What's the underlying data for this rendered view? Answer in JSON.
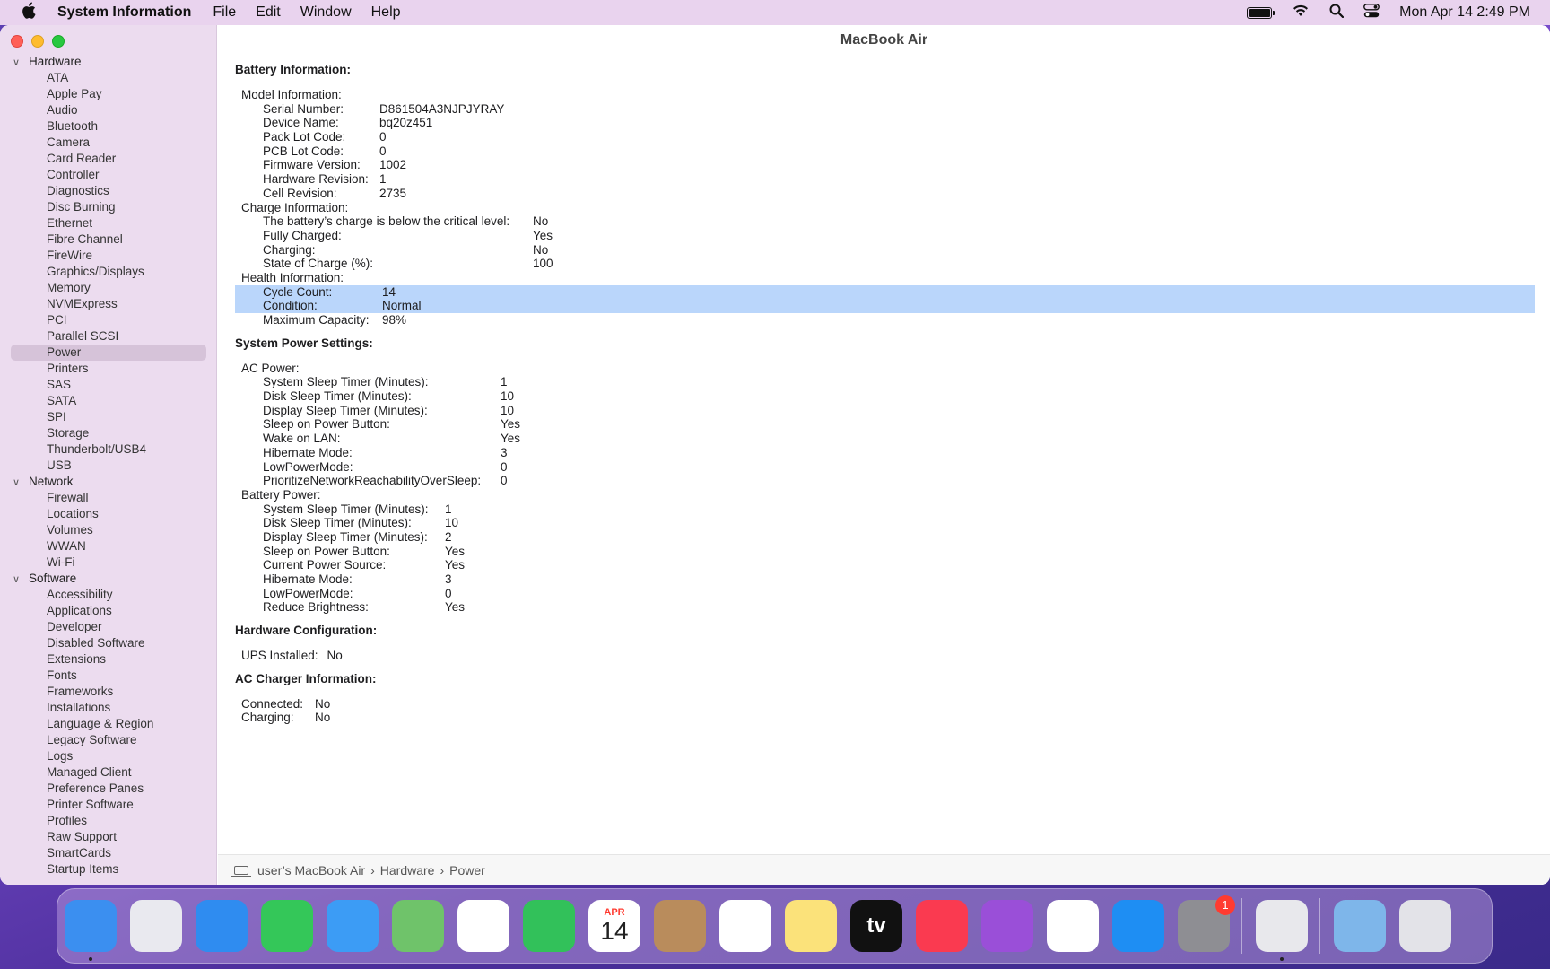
{
  "menubar": {
    "app_name": "System Information",
    "menus": [
      "File",
      "Edit",
      "Window",
      "Help"
    ],
    "clock": "Mon Apr 14  2:49 PM"
  },
  "window": {
    "title": "MacBook Air"
  },
  "sidebar": {
    "groups": [
      {
        "label": "Hardware",
        "items": [
          "ATA",
          "Apple Pay",
          "Audio",
          "Bluetooth",
          "Camera",
          "Card Reader",
          "Controller",
          "Diagnostics",
          "Disc Burning",
          "Ethernet",
          "Fibre Channel",
          "FireWire",
          "Graphics/Displays",
          "Memory",
          "NVMExpress",
          "PCI",
          "Parallel SCSI",
          "Power",
          "Printers",
          "SAS",
          "SATA",
          "SPI",
          "Storage",
          "Thunderbolt/USB4",
          "USB"
        ]
      },
      {
        "label": "Network",
        "items": [
          "Firewall",
          "Locations",
          "Volumes",
          "WWAN",
          "Wi-Fi"
        ]
      },
      {
        "label": "Software",
        "items": [
          "Accessibility",
          "Applications",
          "Developer",
          "Disabled Software",
          "Extensions",
          "Fonts",
          "Frameworks",
          "Installations",
          "Language & Region",
          "Legacy Software",
          "Logs",
          "Managed Client",
          "Preference Panes",
          "Printer Software",
          "Profiles",
          "Raw Support",
          "SmartCards",
          "Startup Items"
        ]
      }
    ],
    "selected": "Power"
  },
  "battery_info": {
    "heading": "Battery Information:",
    "model_label": "Model Information:",
    "model": [
      [
        "Serial Number:",
        "D861504A3NJPJYRAY"
      ],
      [
        "Device Name:",
        "bq20z451"
      ],
      [
        "Pack Lot Code:",
        "0"
      ],
      [
        "PCB Lot Code:",
        "0"
      ],
      [
        "Firmware Version:",
        "1002"
      ],
      [
        "Hardware Revision:",
        "1"
      ],
      [
        "Cell Revision:",
        "2735"
      ]
    ],
    "charge_label": "Charge Information:",
    "charge": [
      [
        "The battery’s charge is below the critical level:",
        "No"
      ],
      [
        "Fully Charged:",
        "Yes"
      ],
      [
        "Charging:",
        "No"
      ],
      [
        "State of Charge (%):",
        "100"
      ]
    ],
    "health_label": "Health Information:",
    "health": [
      [
        "Cycle Count:",
        "14"
      ],
      [
        "Condition:",
        "Normal"
      ],
      [
        "Maximum Capacity:",
        "98%"
      ]
    ]
  },
  "power_settings": {
    "heading": "System Power Settings:",
    "ac_label": "AC Power:",
    "ac": [
      [
        "System Sleep Timer (Minutes):",
        "1"
      ],
      [
        "Disk Sleep Timer (Minutes):",
        "10"
      ],
      [
        "Display Sleep Timer (Minutes):",
        "10"
      ],
      [
        "Sleep on Power Button:",
        "Yes"
      ],
      [
        "Wake on LAN:",
        "Yes"
      ],
      [
        "Hibernate Mode:",
        "3"
      ],
      [
        "LowPowerMode:",
        "0"
      ],
      [
        "PrioritizeNetworkReachabilityOverSleep:",
        "0"
      ]
    ],
    "battery_label": "Battery Power:",
    "battery": [
      [
        "System Sleep Timer (Minutes):",
        "1"
      ],
      [
        "Disk Sleep Timer (Minutes):",
        "10"
      ],
      [
        "Display Sleep Timer (Minutes):",
        "2"
      ],
      [
        "Sleep on Power Button:",
        "Yes"
      ],
      [
        "Current Power Source:",
        "Yes"
      ],
      [
        "Hibernate Mode:",
        "3"
      ],
      [
        "LowPowerMode:",
        "0"
      ],
      [
        "Reduce Brightness:",
        "Yes"
      ]
    ]
  },
  "hardware_config": {
    "heading": "Hardware Configuration:",
    "rows": [
      [
        "UPS Installed:",
        "No"
      ]
    ]
  },
  "ac_charger": {
    "heading": "AC Charger Information:",
    "rows": [
      [
        "Connected:",
        "No"
      ],
      [
        "Charging:",
        "No"
      ]
    ]
  },
  "pathbar": {
    "parts": [
      "user’s MacBook Air",
      "Hardware",
      "Power"
    ],
    "separator": "›"
  },
  "dock": {
    "apps": [
      {
        "name": "Finder",
        "icon": "finder-icon",
        "color": "#3b8ff0",
        "running": true
      },
      {
        "name": "Launchpad",
        "icon": "launchpad-icon",
        "color": "#e9e9ef"
      },
      {
        "name": "Safari",
        "icon": "safari-icon",
        "color": "#2f8cf0"
      },
      {
        "name": "Messages",
        "icon": "messages-icon",
        "color": "#34c759"
      },
      {
        "name": "Mail",
        "icon": "mail-icon",
        "color": "#3c9cf5"
      },
      {
        "name": "Maps",
        "icon": "maps-icon",
        "color": "#6fc36a"
      },
      {
        "name": "Photos",
        "icon": "photos-icon",
        "color": "#ffffff"
      },
      {
        "name": "FaceTime",
        "icon": "facetime-icon",
        "color": "#32c15a"
      },
      {
        "name": "Calendar",
        "icon": "calendar-icon",
        "color": "#ffffff",
        "month": "APR",
        "day": "14"
      },
      {
        "name": "Contacts",
        "icon": "contacts-icon",
        "color": "#b98c5c"
      },
      {
        "name": "Reminders",
        "icon": "reminders-icon",
        "color": "#ffffff"
      },
      {
        "name": "Notes",
        "icon": "notes-icon",
        "color": "#fbe27a"
      },
      {
        "name": "TV",
        "icon": "apple-tv-icon",
        "color": "#111111",
        "label": "tv"
      },
      {
        "name": "Music",
        "icon": "music-icon",
        "color": "#fa3a50"
      },
      {
        "name": "Podcasts",
        "icon": "podcasts-icon",
        "color": "#9a4fd8"
      },
      {
        "name": "News",
        "icon": "news-icon",
        "color": "#ffffff"
      },
      {
        "name": "App Store",
        "icon": "app-store-icon",
        "color": "#1e8ef3"
      },
      {
        "name": "System Preferences",
        "icon": "system-preferences-icon",
        "color": "#8e8e93",
        "badge": "1"
      },
      {
        "name": "System Information",
        "icon": "system-information-icon",
        "color": "#e8e8ec",
        "running": true
      },
      {
        "name": "Downloads",
        "icon": "downloads-folder-icon",
        "color": "#7eb6ea"
      },
      {
        "name": "Trash",
        "icon": "trash-icon",
        "color": "#e3e3e8"
      }
    ]
  }
}
